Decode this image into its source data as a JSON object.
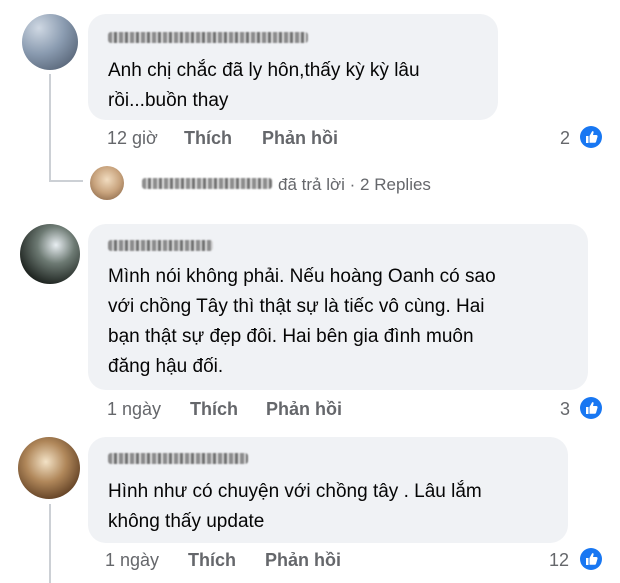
{
  "comments": [
    {
      "text_lines": [
        "Anh chị chắc đã ly hôn,thấy kỳ kỳ lâu",
        "rồi...buồn thay"
      ],
      "time": "12 giờ",
      "like_label": "Thích",
      "reply_label": "Phản hồi",
      "reaction_count": "2"
    },
    {
      "text_lines": [
        "Mình nói không phải. Nếu hoàng Oanh có sao",
        "với chồng Tây thì thật sự là tiếc vô cùng. Hai",
        "bạn thật sự đẹp đôi. Hai bên gia đình muôn",
        "đăng hậu đối."
      ],
      "time": "1 ngày",
      "like_label": "Thích",
      "reply_label": "Phản hồi",
      "reaction_count": "3"
    },
    {
      "text_lines": [
        "Hình như có chuyện với chồng tây . Lâu lắm",
        "không thấy update"
      ],
      "time": "1 ngày",
      "like_label": "Thích",
      "reply_label": "Phản hồi",
      "reaction_count": "12"
    }
  ],
  "reply_summary": {
    "action": "đã trả lời",
    "separator": "·",
    "count": "2 Replies"
  },
  "colors": {
    "bubble": "#f0f2f5",
    "meta": "#65676b",
    "like_blue": "#1877f2"
  }
}
